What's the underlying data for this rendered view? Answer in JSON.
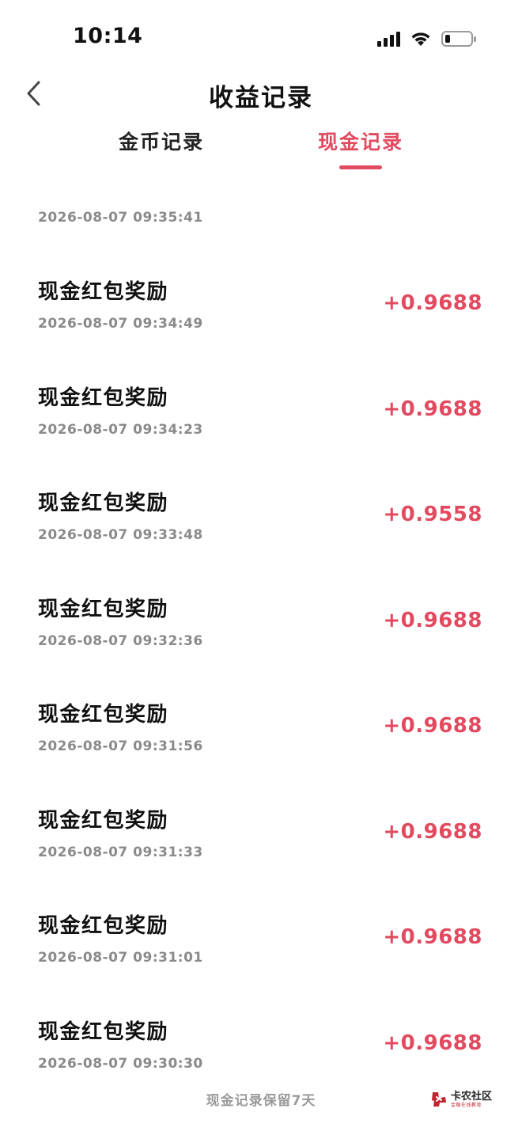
{
  "status_bar": {
    "time": "10:14"
  },
  "nav": {
    "title": "收益记录",
    "back_icon": "chevron-left-icon"
  },
  "tabs": [
    {
      "label": "金币记录",
      "active": false
    },
    {
      "label": "现金记录",
      "active": true
    }
  ],
  "colors": {
    "accent": "#e24a5f",
    "text_primary": "#111111",
    "text_secondary": "#8a8a8a"
  },
  "first_timestamp": "2026-08-07 09:35:41",
  "records": [
    {
      "title": "现金红包奖励",
      "time": "2026-08-07 09:34:49",
      "amount": "+0.9688"
    },
    {
      "title": "现金红包奖励",
      "time": "2026-08-07 09:34:23",
      "amount": "+0.9688"
    },
    {
      "title": "现金红包奖励",
      "time": "2026-08-07 09:33:48",
      "amount": "+0.9558"
    },
    {
      "title": "现金红包奖励",
      "time": "2026-08-07 09:32:36",
      "amount": "+0.9688"
    },
    {
      "title": "现金红包奖励",
      "time": "2026-08-07 09:31:56",
      "amount": "+0.9688"
    },
    {
      "title": "现金红包奖励",
      "time": "2026-08-07 09:31:33",
      "amount": "+0.9688"
    },
    {
      "title": "现金红包奖励",
      "time": "2026-08-07 09:31:01",
      "amount": "+0.9688"
    },
    {
      "title": "现金红包奖励",
      "time": "2026-08-07 09:30:30",
      "amount": "+0.9688"
    }
  ],
  "footer": {
    "note": "现金记录保留7天"
  },
  "watermark": {
    "name": "卡农社区",
    "slogan": "金融在线教育"
  }
}
